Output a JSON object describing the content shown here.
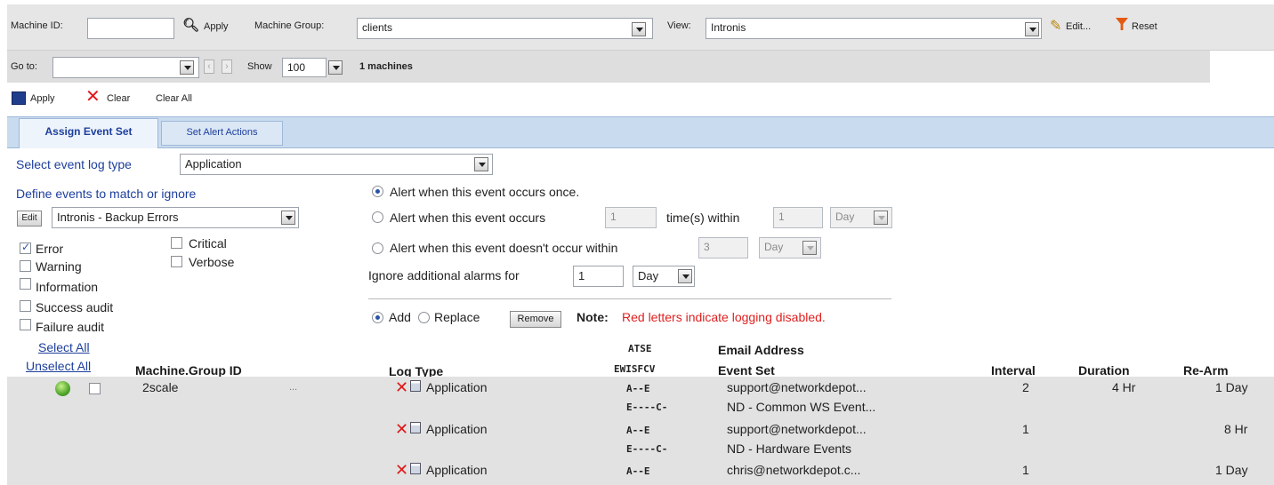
{
  "toolbar": {
    "machine_id_label": "Machine ID:",
    "machine_id_value": "",
    "apply_label": "Apply",
    "machine_group_label": "Machine Group:",
    "machine_group_value": "clients",
    "view_label": "View:",
    "view_value": "Intronis",
    "edit_label": "Edit...",
    "reset_label": "Reset"
  },
  "nav": {
    "goto_label": "Go to:",
    "show_label": "Show",
    "show_value": "100",
    "machines_count": "1 machines"
  },
  "actions": {
    "apply": "Apply",
    "clear": "Clear",
    "clear_all": "Clear All"
  },
  "tabs": [
    {
      "label": "Assign Event Set",
      "active": true
    },
    {
      "label": "Set Alert Actions",
      "active": false
    }
  ],
  "form": {
    "log_type_label": "Select event log type",
    "log_type_value": "Application",
    "define_label": "Define events to match or ignore",
    "edit_btn": "Edit",
    "event_set_value": "Intronis - Backup Errors",
    "checkboxes": {
      "error": {
        "label": "Error",
        "checked": true
      },
      "warning": {
        "label": "Warning",
        "checked": false
      },
      "information": {
        "label": "Information",
        "checked": false
      },
      "success_audit": {
        "label": "Success audit",
        "checked": false
      },
      "failure_audit": {
        "label": "Failure audit",
        "checked": false
      },
      "critical": {
        "label": "Critical",
        "checked": false
      },
      "verbose": {
        "label": "Verbose",
        "checked": false
      }
    },
    "alert_once": "Alert when this event occurs once.",
    "alert_occurs": "Alert when this event occurs",
    "alert_occurs_count": "1",
    "times_within": "time(s) within",
    "alert_occurs_within": "1",
    "unit_day": "Day",
    "alert_not_occur": "Alert when this event doesn't occur within",
    "alert_not_occur_value": "3",
    "ignore_label": "Ignore additional alarms for",
    "ignore_value": "1",
    "add_label": "Add",
    "replace_label": "Replace",
    "remove_btn": "Remove",
    "note_label": "Note:",
    "note_text": "Red letters indicate logging disabled."
  },
  "table": {
    "select_all": "Select All",
    "unselect_all": "Unselect All",
    "col_machine": "Machine.Group ID",
    "col_logtype": "Log Type",
    "col_atse": "ATSE",
    "col_ewis": "EWISFCV",
    "col_email": "Email Address",
    "col_eventset": "Event Set",
    "col_interval": "Interval",
    "col_duration": "Duration",
    "col_rearm": "Re-Arm",
    "machine": "2scale",
    "machine_suffix": "...",
    "rows": [
      {
        "log": "Application",
        "atse": "A--E",
        "ewis": "E----C-",
        "email": "support@networkdepot...",
        "eventset": "ND - Common WS Event...",
        "interval": "2",
        "duration": "4 Hr",
        "rearm": "1 Day"
      },
      {
        "log": "Application",
        "atse": "A--E",
        "ewis": "E----C-",
        "email": "support@networkdepot...",
        "eventset": "ND - Hardware Events",
        "interval": "1",
        "duration": "",
        "rearm": "8 Hr"
      },
      {
        "log": "Application",
        "atse": "A--E",
        "ewis": "",
        "email": "chris@networkdepot.c...",
        "eventset": "",
        "interval": "1",
        "duration": "",
        "rearm": "1 Day"
      }
    ]
  },
  "colors": {
    "accent_blue": "#1d3f9c",
    "tab_bar": "#c9dbef",
    "row_bg": "#e2e2e2",
    "note_red": "#e02020"
  }
}
